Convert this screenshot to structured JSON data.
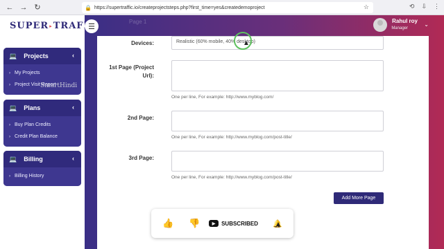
{
  "browser": {
    "back": "←",
    "forward": "→",
    "refresh": "↻",
    "url": "https://supertraffic.io/createprojectsteps.php?first_time=yes&createdemoproject"
  },
  "brand": {
    "part1": "SUPER",
    "part2": "TRAFFIC"
  },
  "header": {
    "crumb": "Page 1",
    "user_name": "Rahul roy",
    "user_role": "Manager"
  },
  "watermark": "SmartHindi",
  "sidebar": {
    "projects": {
      "title": "Projects",
      "items": [
        "My Projects",
        "Project Visit Report"
      ]
    },
    "plans": {
      "title": "Plans",
      "items": [
        "Buy Plan Credits",
        "Credit Plan Balance"
      ]
    },
    "billing": {
      "title": "Billing",
      "items": [
        "Billing History"
      ]
    }
  },
  "form": {
    "devices_label": "Devices:",
    "devices_value": "Realistic (60% mobile, 40% desktop)",
    "page1_label": "1st Page (Project Url):",
    "page1_hint": "One per line, For example: http://www.myblog.com/",
    "page2_label": "2nd Page:",
    "page2_hint": "One per line, For example: http://www.myblog.com/post-title/",
    "page3_label": "3rd Page:",
    "page3_hint": "One per line, For example: http://www.myblog.com/post-title/",
    "add_more": "Add More Page"
  },
  "social": {
    "subscribed": "SUBSCRIBED"
  }
}
